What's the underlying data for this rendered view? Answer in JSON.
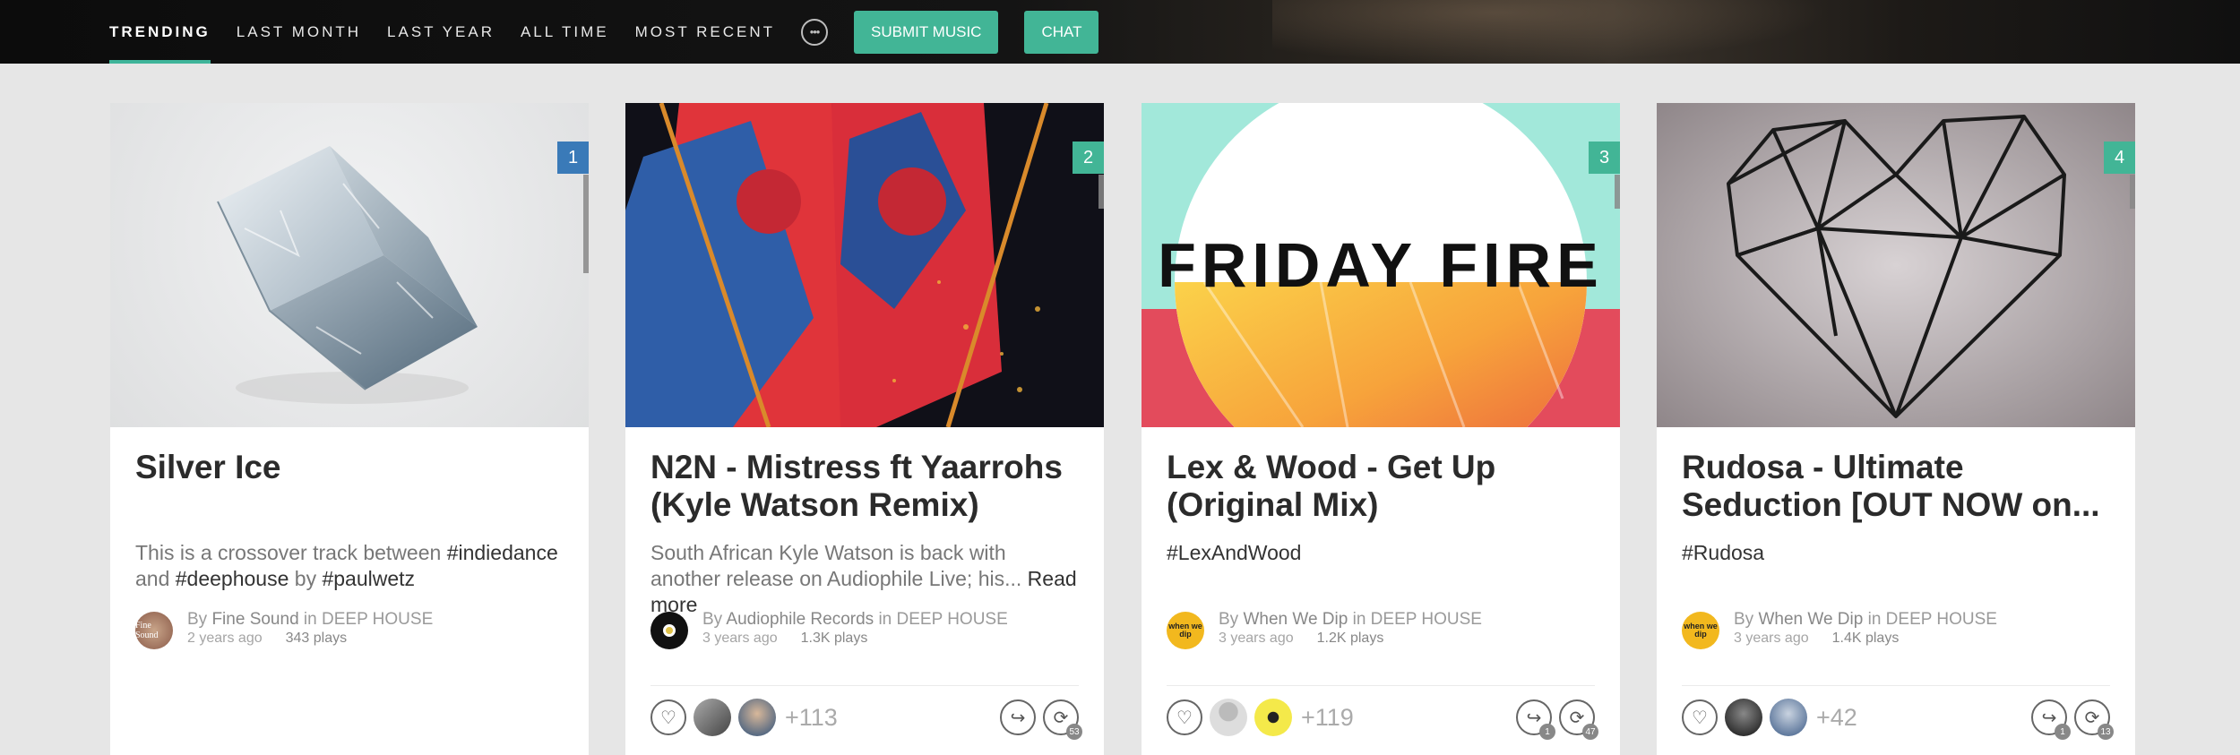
{
  "nav": {
    "tabs": [
      "TRENDING",
      "LAST MONTH",
      "LAST YEAR",
      "ALL TIME",
      "MOST RECENT"
    ],
    "active_tab": "TRENDING",
    "more_icon": "more-dots-icon",
    "submit_label": "SUBMIT MUSIC",
    "chat_label": "CHAT",
    "accent_color": "#42b596"
  },
  "cards": [
    {
      "rank": "1",
      "title": "Silver Ice",
      "desc_parts": [
        "This is a crossover track between ",
        "#indiedance",
        " and ",
        "#deephouse",
        " by ",
        "#paulwetz"
      ],
      "by_prefix": "By ",
      "author": "Fine Sound",
      "in_word": " in ",
      "genre": "DEEP HOUSE",
      "age": "2 years ago",
      "plays": "343 plays"
    },
    {
      "rank": "2",
      "title": "N2N - Mistress ft Yaarrohs (Kyle Watson Remix)",
      "desc": "South African Kyle Watson is back with another release on Audiophile Live; his... ",
      "read_more": "Read more",
      "by_prefix": "By ",
      "author": "Audiophile Records",
      "in_word": " in ",
      "genre": "DEEP HOUSE",
      "age": "3 years ago",
      "plays": "1.3K plays",
      "like_count": "+113"
    },
    {
      "rank": "3",
      "art_text": "FRIDAY FIRE",
      "title": "Lex & Wood - Get Up (Original Mix)",
      "desc": "#LexAndWood",
      "by_prefix": "By ",
      "author": "When We Dip",
      "in_word": " in ",
      "genre": "DEEP HOUSE",
      "age": "3 years ago",
      "plays": "1.2K plays",
      "like_count": "+119",
      "share_badge": "1",
      "repost_badge": "47"
    },
    {
      "rank": "4",
      "title": "Rudosa - Ultimate Seduction [OUT NOW on...",
      "desc": "#Rudosa",
      "by_prefix": "By ",
      "author": "When We Dip",
      "in_word": " in ",
      "genre": "DEEP HOUSE",
      "age": "3 years ago",
      "plays": "1.4K plays",
      "like_count": "+42",
      "share_badge": "1",
      "repost_badge": "13",
      "avatar_text": "when we dip"
    }
  ],
  "card2_avatar_text": "",
  "card2_repost_badge": "53",
  "card1_avatar_text": "Fine Sound",
  "card3_avatar_text": "when we dip"
}
